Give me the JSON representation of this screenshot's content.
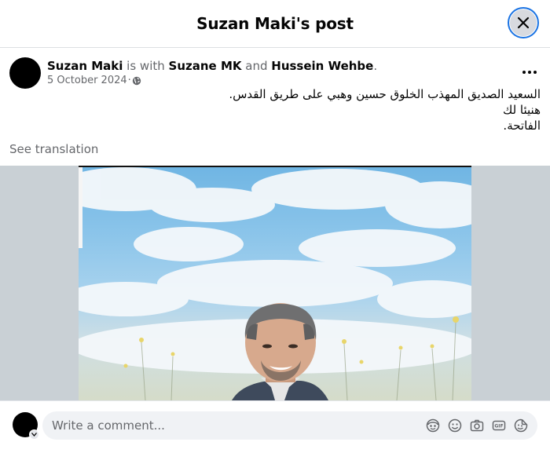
{
  "header": {
    "title": "Suzan Maki's post",
    "close_icon": "close-icon"
  },
  "post": {
    "author": "Suzan Maki",
    "with_text": " is with ",
    "tagged_1": "Suzane MK",
    "and_text": " and ",
    "tagged_2": "Hussein Wehbe",
    "period": ".",
    "date": "5 October 2024",
    "separator": " · ",
    "audience_icon": "globe-icon",
    "more_icon": "more-dots-icon",
    "lines": [
      "السعيد الصديق المهذب الخلوق حسين وهبي على طريق القدس.",
      "هنيئا لك",
      "الفاتحة."
    ],
    "see_translation": "See translation"
  },
  "comment": {
    "placeholder": "Write a comment...",
    "icons": [
      "avatar-sticker-icon",
      "emoji-icon",
      "camera-icon",
      "gif-icon",
      "sticker-icon"
    ]
  },
  "colors": {
    "accent": "#1b74e4",
    "secondary_text": "#65676b",
    "photo_backdrop": "#c9d0d5"
  }
}
